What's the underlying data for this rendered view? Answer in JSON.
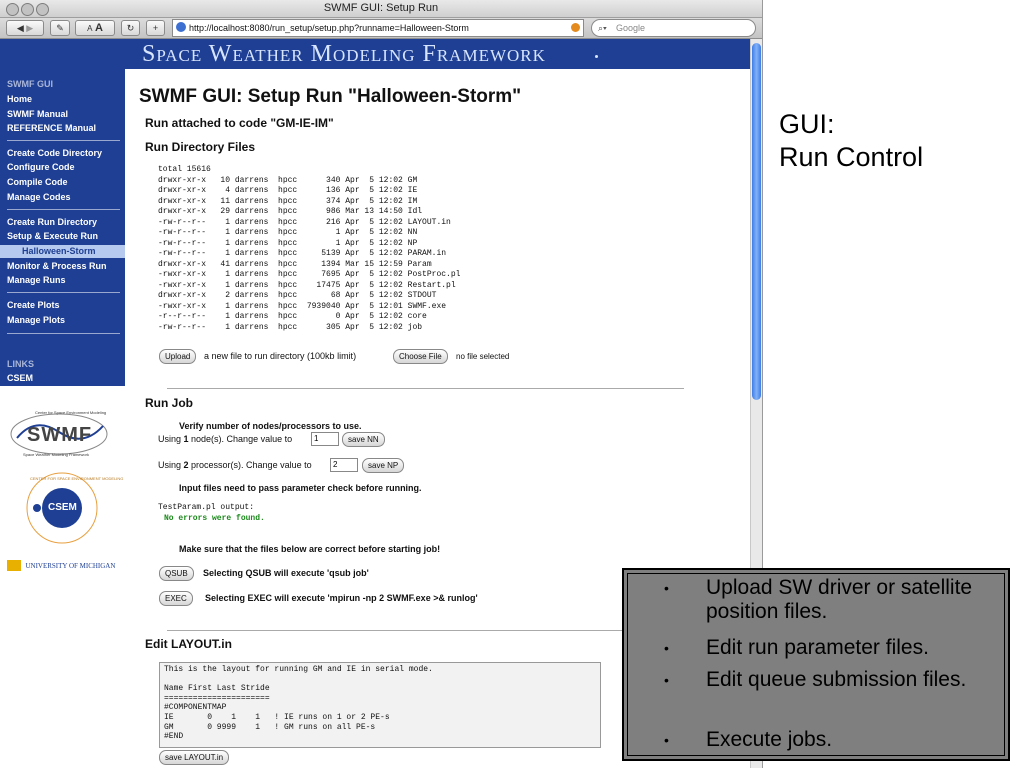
{
  "browser": {
    "window_title": "SWMF GUI: Setup Run",
    "url": "http://localhost:8080/run_setup/setup.php?runname=Halloween-Storm",
    "search_placeholder": "Google",
    "text_small": "A",
    "text_large": "A"
  },
  "banner": {
    "title": "Space Weather Modeling Framework"
  },
  "sidebar": {
    "header": "SWMF GUI",
    "items": [
      "Home",
      "SWMF Manual",
      "REFERENCE Manual",
      "Create Code Directory",
      "Configure Code",
      "Compile Code",
      "Manage Codes",
      "Create Run Directory",
      "Setup & Execute Run",
      "Halloween-Storm",
      "Monitor & Process Run",
      "Manage Runs",
      "Create Plots",
      "Manage Plots"
    ],
    "links_header": "LINKS",
    "links": [
      "CSEM"
    ]
  },
  "logos": {
    "swmf_ring": "Center for Space Environment Modeling",
    "swmf_name": "SWMF",
    "swmf_sub": "Space Weather Modeling Framework",
    "csem_ring": "CENTER FOR SPACE ENVIRONMENT MODELING",
    "csem_name": "CSEM",
    "umich": "UNIVERSITY OF MICHIGAN"
  },
  "main": {
    "title": "SWMF GUI: Setup Run \"Halloween-Storm\"",
    "attached": "Run attached to code \"GM-IE-IM\"",
    "dir_heading": "Run Directory Files",
    "ls_total": "total 15616",
    "ls_rows": [
      "drwxr-xr-x   10 darrens  hpcc      340 Apr  5 12:02 GM",
      "drwxr-xr-x    4 darrens  hpcc      136 Apr  5 12:02 IE",
      "drwxr-xr-x   11 darrens  hpcc      374 Apr  5 12:02 IM",
      "drwxr-xr-x   29 darrens  hpcc      986 Mar 13 14:50 Idl",
      "-rw-r--r--    1 darrens  hpcc      216 Apr  5 12:02 LAYOUT.in",
      "-rw-r--r--    1 darrens  hpcc        1 Apr  5 12:02 NN",
      "-rw-r--r--    1 darrens  hpcc        1 Apr  5 12:02 NP",
      "-rw-r--r--    1 darrens  hpcc     5139 Apr  5 12:02 PARAM.in",
      "drwxr-xr-x   41 darrens  hpcc     1394 Mar 15 12:59 Param",
      "-rwxr-xr-x    1 darrens  hpcc     7695 Apr  5 12:02 PostProc.pl",
      "-rwxr-xr-x    1 darrens  hpcc    17475 Apr  5 12:02 Restart.pl",
      "drwxr-xr-x    2 darrens  hpcc       68 Apr  5 12:02 STDOUT",
      "-rwxr-xr-x    1 darrens  hpcc  7939040 Apr  5 12:01 SWMF.exe",
      "-r--r--r--    1 darrens  hpcc        0 Apr  5 12:02 core",
      "-rw-r--r--    1 darrens  hpcc      305 Apr  5 12:02 job"
    ],
    "upload_button": "Upload",
    "upload_text": "a new file to run directory (100kb limit)",
    "choose_button": "Choose File",
    "no_file": "no file selected",
    "run_job_heading": "Run Job",
    "verify_text": "Verify number of nodes/processors to use.",
    "nodes_pre": "Using ",
    "nodes_num": "1",
    "nodes_post": " node(s). Change value to",
    "nn_value": "1",
    "save_nn": "save NN",
    "procs_pre": "Using ",
    "procs_num": "2",
    "procs_post": " processor(s). Change value to",
    "np_value": "2",
    "save_np": "save NP",
    "param_check": "Input files need to pass parameter check before running.",
    "testparam_label": "TestParam.pl output:",
    "testparam_result": "No errors were found.",
    "files_correct": "Make sure that the files below are correct before starting job!",
    "qsub_button": "QSUB",
    "qsub_text": "Selecting QSUB will execute 'qsub job'",
    "exec_button": "EXEC",
    "exec_text": "Selecting EXEC will execute 'mpirun -np 2 SWMF.exe >& runlog'",
    "edit_heading": "Edit LAYOUT.in",
    "layout_lines": [
      "This is the layout for running GM and IE in serial mode.",
      "",
      "Name First Last Stride",
      "======================",
      "#COMPONENTMAP",
      "IE       0    1    1   ! IE runs on 1 or 2 PE-s",
      "GM       0 9999    1   ! GM runs on all PE-s",
      "#END"
    ],
    "save_layout": "save LAYOUT.in"
  },
  "slide": {
    "title_line1": "GUI:",
    "title_line2": "Run Control",
    "bullets": [
      "Upload SW driver or satellite position files.",
      "Edit run parameter files.",
      "Edit queue submission files.",
      "Execute jobs."
    ],
    "bullet_symbol": "•"
  },
  "colors": {
    "banner": "#1e3f93",
    "sidebar": "#1e3f93",
    "selected": "#b6c9ee",
    "ok_green": "#1a8a1a",
    "bullet_box": "#7f7f7f"
  }
}
